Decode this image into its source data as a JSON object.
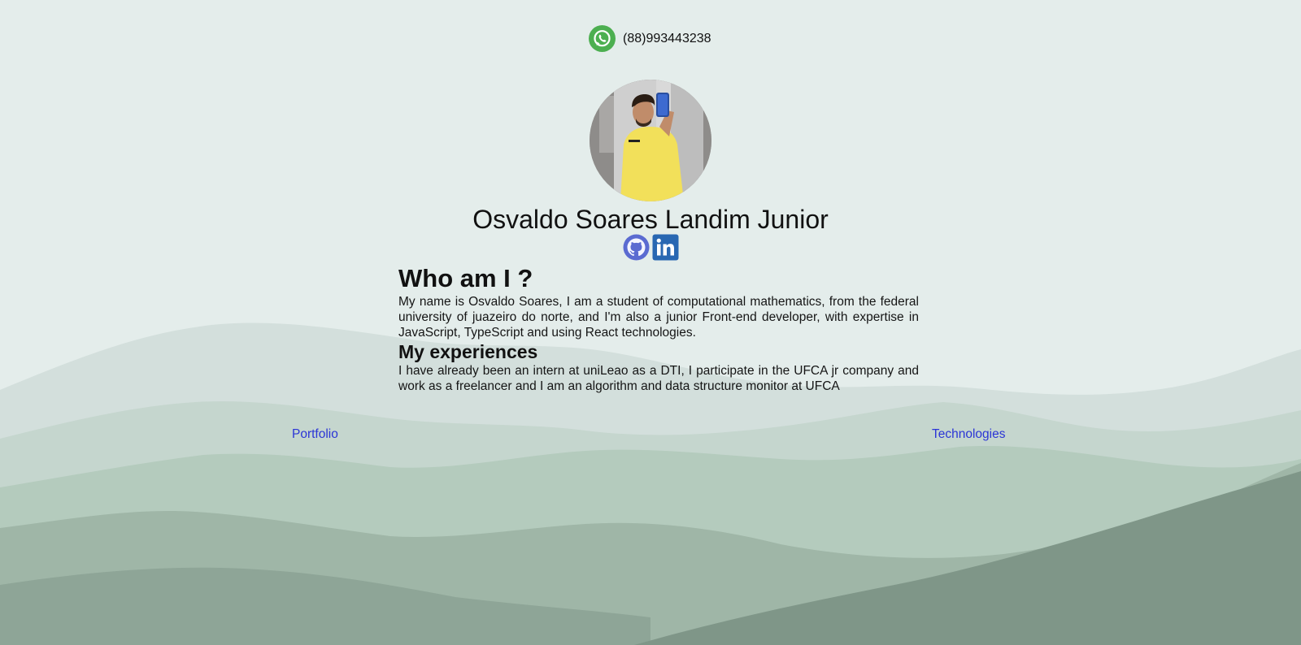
{
  "contact": {
    "phone": "(88)993443238",
    "icon": "whatsapp-icon",
    "accent_color": "#4caf50"
  },
  "profile": {
    "name": "Osvaldo Soares Landim Junior",
    "avatar_icon": "profile-photo"
  },
  "socials": [
    {
      "icon": "github-icon",
      "color": "#5b6bd1"
    },
    {
      "icon": "linkedin-icon",
      "color": "#2867b2"
    }
  ],
  "about": {
    "heading": "Who am I ?",
    "text": "My name is Osvaldo Soares, I am a student of computational mathematics, from the federal university of juazeiro do norte, and I'm also a junior Front-end developer, with expertise in JavaScript, TypeScript and using React technologies."
  },
  "experiences": {
    "heading": "My experiences",
    "text": "I have already been an intern at uniLeao as a DTI, I participate in the UFCA jr company and work as a freelancer and I am an algorithm and data structure monitor at UFCA"
  },
  "nav": {
    "portfolio_label": "Portfolio",
    "technologies_label": "Technologies",
    "link_color": "#2b35d6"
  }
}
